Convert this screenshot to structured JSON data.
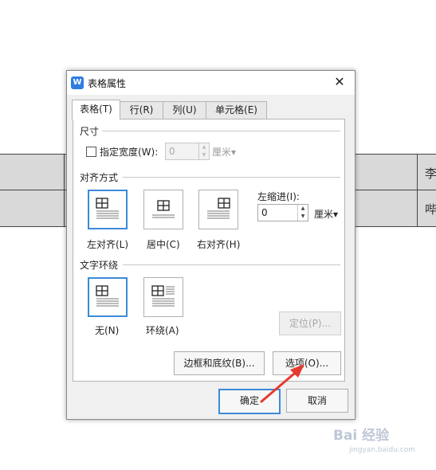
{
  "background_doc": {
    "cell_texts": [
      "李",
      "哔"
    ]
  },
  "dialog": {
    "title": "表格属性",
    "app_icon_letter": "W",
    "close_glyph": "✕",
    "tabs": [
      {
        "label": "表格(T)",
        "active": true
      },
      {
        "label": "行(R)",
        "active": false
      },
      {
        "label": "列(U)",
        "active": false
      },
      {
        "label": "单元格(E)",
        "active": false
      }
    ],
    "size_section": {
      "title": "尺寸",
      "specify_width_label": "指定宽度(W):",
      "specify_width_checked": false,
      "width_value": "0",
      "width_unit": "厘米▾"
    },
    "align_section": {
      "title": "对齐方式",
      "options": [
        {
          "label": "左对齐(L)",
          "selected": true
        },
        {
          "label": "居中(C)",
          "selected": false
        },
        {
          "label": "右对齐(H)",
          "selected": false
        }
      ],
      "indent_label": "左缩进(I):",
      "indent_value": "0",
      "indent_unit": "厘米▾"
    },
    "wrap_section": {
      "title": "文字环绕",
      "options": [
        {
          "label": "无(N)",
          "selected": true
        },
        {
          "label": "环绕(A)",
          "selected": false
        }
      ],
      "position_button": "定位(P)..."
    },
    "buttons": {
      "borders_shading": "边框和底纹(B)...",
      "options": "选项(O)...",
      "ok": "确定",
      "cancel": "取消"
    }
  },
  "annotation": {
    "arrow_color": "#e53a2e"
  },
  "watermark": {
    "text": "Bai 经验",
    "sub": "jingyan.baidu.com"
  },
  "colors": {
    "accent": "#3c8ad8",
    "app_icon": "#2f7de1"
  }
}
